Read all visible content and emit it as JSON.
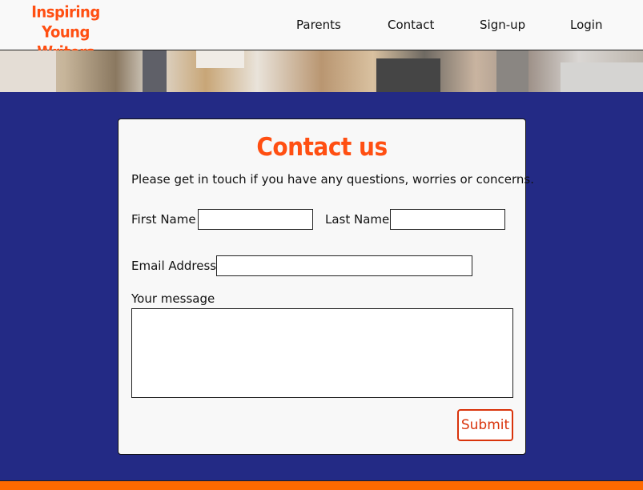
{
  "brand": {
    "logo_line1": "Inspiring Young",
    "logo_line2": "Writers",
    "accent_color": "#ff4f12",
    "background_color": "#232a85",
    "footer_color": "#ff6a00"
  },
  "nav": {
    "items": [
      {
        "label": "Parents"
      },
      {
        "label": "Contact"
      },
      {
        "label": "Sign-up"
      },
      {
        "label": "Login"
      }
    ]
  },
  "contact": {
    "title": "Contact us",
    "intro": "Please get in touch if you have any questions, worries or concerns.",
    "first_name_label": "First Name",
    "first_name_value": "",
    "last_name_label": "Last Name",
    "last_name_value": "",
    "email_label": "Email Address",
    "email_value": "",
    "message_label": "Your message",
    "message_value": "",
    "submit_label": "Submit"
  }
}
